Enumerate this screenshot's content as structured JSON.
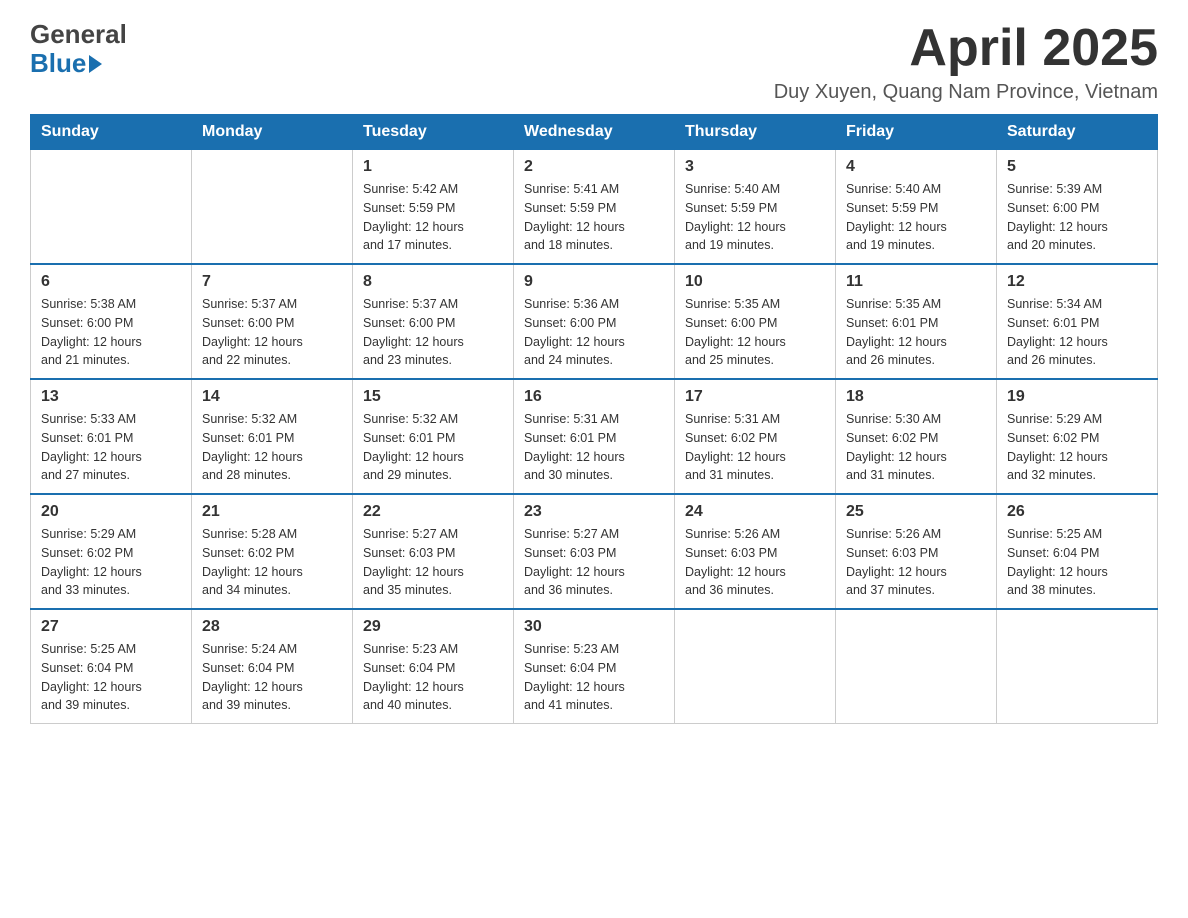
{
  "header": {
    "logo_line1": "General",
    "logo_line2": "Blue",
    "title": "April 2025",
    "location": "Duy Xuyen, Quang Nam Province, Vietnam"
  },
  "days_of_week": [
    "Sunday",
    "Monday",
    "Tuesday",
    "Wednesday",
    "Thursday",
    "Friday",
    "Saturday"
  ],
  "weeks": [
    [
      {
        "day": "",
        "info": ""
      },
      {
        "day": "",
        "info": ""
      },
      {
        "day": "1",
        "info": "Sunrise: 5:42 AM\nSunset: 5:59 PM\nDaylight: 12 hours\nand 17 minutes."
      },
      {
        "day": "2",
        "info": "Sunrise: 5:41 AM\nSunset: 5:59 PM\nDaylight: 12 hours\nand 18 minutes."
      },
      {
        "day": "3",
        "info": "Sunrise: 5:40 AM\nSunset: 5:59 PM\nDaylight: 12 hours\nand 19 minutes."
      },
      {
        "day": "4",
        "info": "Sunrise: 5:40 AM\nSunset: 5:59 PM\nDaylight: 12 hours\nand 19 minutes."
      },
      {
        "day": "5",
        "info": "Sunrise: 5:39 AM\nSunset: 6:00 PM\nDaylight: 12 hours\nand 20 minutes."
      }
    ],
    [
      {
        "day": "6",
        "info": "Sunrise: 5:38 AM\nSunset: 6:00 PM\nDaylight: 12 hours\nand 21 minutes."
      },
      {
        "day": "7",
        "info": "Sunrise: 5:37 AM\nSunset: 6:00 PM\nDaylight: 12 hours\nand 22 minutes."
      },
      {
        "day": "8",
        "info": "Sunrise: 5:37 AM\nSunset: 6:00 PM\nDaylight: 12 hours\nand 23 minutes."
      },
      {
        "day": "9",
        "info": "Sunrise: 5:36 AM\nSunset: 6:00 PM\nDaylight: 12 hours\nand 24 minutes."
      },
      {
        "day": "10",
        "info": "Sunrise: 5:35 AM\nSunset: 6:00 PM\nDaylight: 12 hours\nand 25 minutes."
      },
      {
        "day": "11",
        "info": "Sunrise: 5:35 AM\nSunset: 6:01 PM\nDaylight: 12 hours\nand 26 minutes."
      },
      {
        "day": "12",
        "info": "Sunrise: 5:34 AM\nSunset: 6:01 PM\nDaylight: 12 hours\nand 26 minutes."
      }
    ],
    [
      {
        "day": "13",
        "info": "Sunrise: 5:33 AM\nSunset: 6:01 PM\nDaylight: 12 hours\nand 27 minutes."
      },
      {
        "day": "14",
        "info": "Sunrise: 5:32 AM\nSunset: 6:01 PM\nDaylight: 12 hours\nand 28 minutes."
      },
      {
        "day": "15",
        "info": "Sunrise: 5:32 AM\nSunset: 6:01 PM\nDaylight: 12 hours\nand 29 minutes."
      },
      {
        "day": "16",
        "info": "Sunrise: 5:31 AM\nSunset: 6:01 PM\nDaylight: 12 hours\nand 30 minutes."
      },
      {
        "day": "17",
        "info": "Sunrise: 5:31 AM\nSunset: 6:02 PM\nDaylight: 12 hours\nand 31 minutes."
      },
      {
        "day": "18",
        "info": "Sunrise: 5:30 AM\nSunset: 6:02 PM\nDaylight: 12 hours\nand 31 minutes."
      },
      {
        "day": "19",
        "info": "Sunrise: 5:29 AM\nSunset: 6:02 PM\nDaylight: 12 hours\nand 32 minutes."
      }
    ],
    [
      {
        "day": "20",
        "info": "Sunrise: 5:29 AM\nSunset: 6:02 PM\nDaylight: 12 hours\nand 33 minutes."
      },
      {
        "day": "21",
        "info": "Sunrise: 5:28 AM\nSunset: 6:02 PM\nDaylight: 12 hours\nand 34 minutes."
      },
      {
        "day": "22",
        "info": "Sunrise: 5:27 AM\nSunset: 6:03 PM\nDaylight: 12 hours\nand 35 minutes."
      },
      {
        "day": "23",
        "info": "Sunrise: 5:27 AM\nSunset: 6:03 PM\nDaylight: 12 hours\nand 36 minutes."
      },
      {
        "day": "24",
        "info": "Sunrise: 5:26 AM\nSunset: 6:03 PM\nDaylight: 12 hours\nand 36 minutes."
      },
      {
        "day": "25",
        "info": "Sunrise: 5:26 AM\nSunset: 6:03 PM\nDaylight: 12 hours\nand 37 minutes."
      },
      {
        "day": "26",
        "info": "Sunrise: 5:25 AM\nSunset: 6:04 PM\nDaylight: 12 hours\nand 38 minutes."
      }
    ],
    [
      {
        "day": "27",
        "info": "Sunrise: 5:25 AM\nSunset: 6:04 PM\nDaylight: 12 hours\nand 39 minutes."
      },
      {
        "day": "28",
        "info": "Sunrise: 5:24 AM\nSunset: 6:04 PM\nDaylight: 12 hours\nand 39 minutes."
      },
      {
        "day": "29",
        "info": "Sunrise: 5:23 AM\nSunset: 6:04 PM\nDaylight: 12 hours\nand 40 minutes."
      },
      {
        "day": "30",
        "info": "Sunrise: 5:23 AM\nSunset: 6:04 PM\nDaylight: 12 hours\nand 41 minutes."
      },
      {
        "day": "",
        "info": ""
      },
      {
        "day": "",
        "info": ""
      },
      {
        "day": "",
        "info": ""
      }
    ]
  ]
}
